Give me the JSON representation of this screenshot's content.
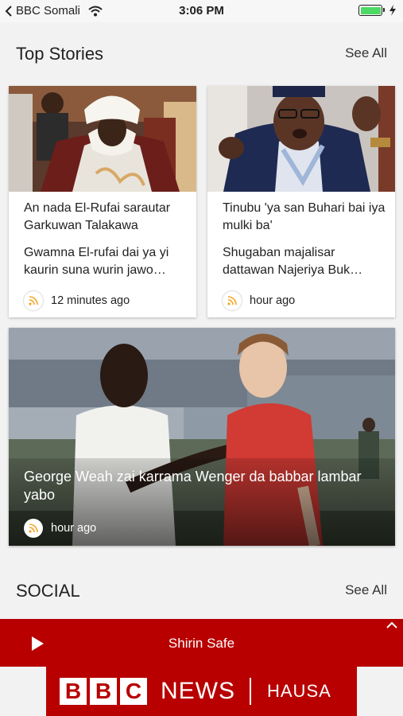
{
  "status_bar": {
    "back_app": "BBC Somali",
    "time": "3:06 PM",
    "battery_level": 1.0,
    "battery_color": "#4cd964"
  },
  "top_stories": {
    "title": "Top Stories",
    "see_all": "See All",
    "cards": [
      {
        "title": "An nada El-Rufai sarautar Garkuwan Talakawa",
        "summary": "Gwamna El-rufai dai ya yi kaurin suna wurin jawo…",
        "time": "12 minutes ago",
        "icon": "rss-icon"
      },
      {
        "title": "Tinubu 'ya san Buhari bai iya mulki ba'",
        "summary": "Shugaban majalisar dattawan Najeriya Buk…",
        "time": "hour ago",
        "icon": "rss-icon"
      }
    ],
    "feature": {
      "title": "George Weah zai karrama Wenger da babbar lambar yabo",
      "time": "hour ago",
      "icon": "rss-icon"
    }
  },
  "social": {
    "title": "SOCIAL",
    "see_all": "See All"
  },
  "player": {
    "title": "Shirin Safe",
    "play_icon": "play-icon",
    "expand_icon": "chevron-up-icon"
  },
  "brand": {
    "letters": [
      "B",
      "B",
      "C"
    ],
    "news": "NEWS",
    "service": "HAUSA",
    "color": "#b80000"
  }
}
